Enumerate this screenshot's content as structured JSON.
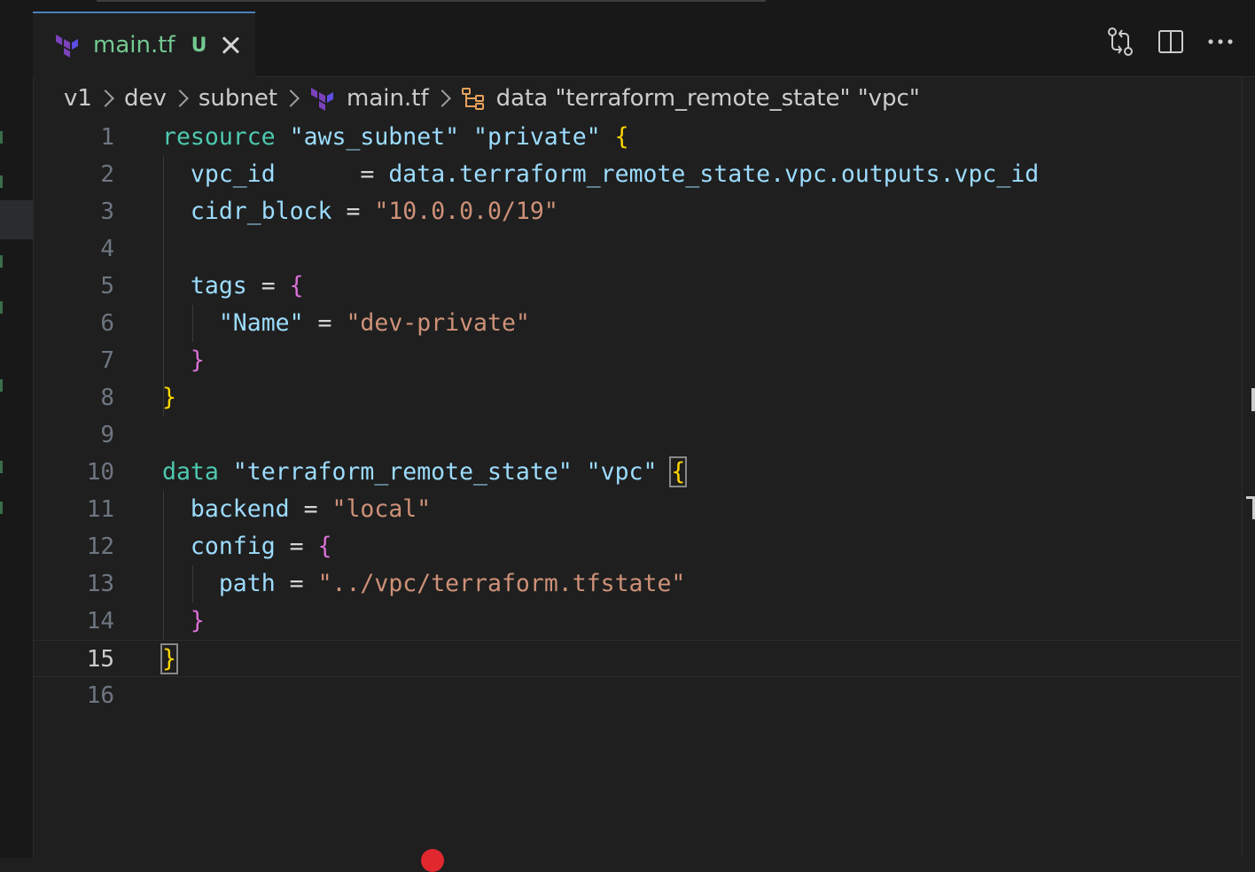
{
  "tab": {
    "icon": "terraform-icon",
    "filename": "main.tf",
    "git_status": "U"
  },
  "toolbar": {
    "icons": [
      "compare-changes-icon",
      "split-editor-icon",
      "more-actions-icon"
    ]
  },
  "breadcrumb": {
    "items": [
      "v1",
      "dev",
      "subnet",
      "main.tf",
      "data \"terraform_remote_state\" \"vpc\""
    ],
    "icons": [
      "",
      "",
      "",
      "terraform-icon",
      "symbol-structure-icon"
    ]
  },
  "editor": {
    "active_line": 15,
    "line_numbers": [
      "1",
      "2",
      "3",
      "4",
      "5",
      "6",
      "7",
      "8",
      "9",
      "10",
      "11",
      "12",
      "13",
      "14",
      "15",
      "16"
    ],
    "lines": {
      "l1": {
        "kw": "resource",
        "s1": "\"aws_subnet\"",
        "s2": "\"private\"",
        "brace": "{"
      },
      "l2": {
        "attr": "vpc_id",
        "pad": "     ",
        "op": "=",
        "value": "data.terraform_remote_state.vpc.outputs.vpc_id"
      },
      "l3": {
        "attr": "cidr_block",
        "op": "=",
        "value": "\"10.0.0.0/19\""
      },
      "l5": {
        "attr": "tags",
        "op": "=",
        "brace": "{"
      },
      "l6": {
        "key": "\"Name\"",
        "op": "=",
        "value": "\"dev-private\""
      },
      "l7": {
        "brace": "}"
      },
      "l8": {
        "brace": "}"
      },
      "l10": {
        "kw": "data",
        "s1": "\"terraform_remote_state\"",
        "s2": "\"vpc\"",
        "brace": "{"
      },
      "l11": {
        "attr": "backend",
        "op": "=",
        "value": "\"local\""
      },
      "l12": {
        "attr": "config",
        "op": "=",
        "brace": "{"
      },
      "l13": {
        "attr": "path",
        "op": "=",
        "value": "\"../vpc/terraform.tfstate\""
      },
      "l14": {
        "brace": "}"
      },
      "l15": {
        "brace": "}"
      }
    }
  },
  "colors": {
    "keyword": "#4ec9b0",
    "string": "#ce9178",
    "modified": "#73c991",
    "bracket_level1": "#ffd700",
    "bracket_level2": "#da70d6"
  }
}
